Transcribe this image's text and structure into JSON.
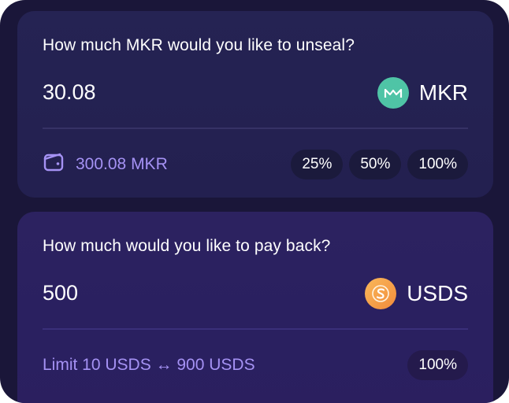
{
  "unseal": {
    "question": "How much MKR would you like to unseal?",
    "amount": "30.08",
    "token": {
      "label": "MKR",
      "icon": "mkr-token-icon",
      "color": "#4fc4a6"
    },
    "balance": "300.08 MKR",
    "balance_icon": "wallet-icon",
    "percent_buttons": [
      "25%",
      "50%",
      "100%"
    ]
  },
  "payback": {
    "question": "How much would you like to pay back?",
    "amount": "500",
    "token": {
      "label": "USDS",
      "icon": "usds-token-icon",
      "color": "#f7a54a"
    },
    "limit": "Limit 10 USDS ↔ 900 USDS",
    "percent_buttons": [
      "100%"
    ]
  },
  "colors": {
    "accent_text": "#a592f4",
    "background": "#1a1639"
  }
}
